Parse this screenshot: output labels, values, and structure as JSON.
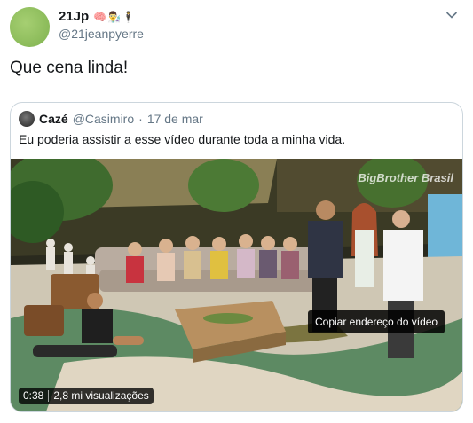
{
  "tweet": {
    "display_name": "21Jp",
    "name_emojis": "🧠👨‍🔬🕴",
    "handle": "@21jeanpyerre",
    "text": "Que cena linda!",
    "menu_icon": "chevron-down-icon"
  },
  "quoted_tweet": {
    "display_name": "Cazé",
    "handle": "@Casimiro",
    "separator": "·",
    "date": "17 de mar",
    "text": "Eu poderia assistir a esse vídeo durante toda a minha vida.",
    "video": {
      "watermark": "BigBrother Brasil",
      "duration": "0:38",
      "views": "2,8 mi visualizações",
      "context_menu_item": "Copiar endereço do vídeo"
    }
  }
}
